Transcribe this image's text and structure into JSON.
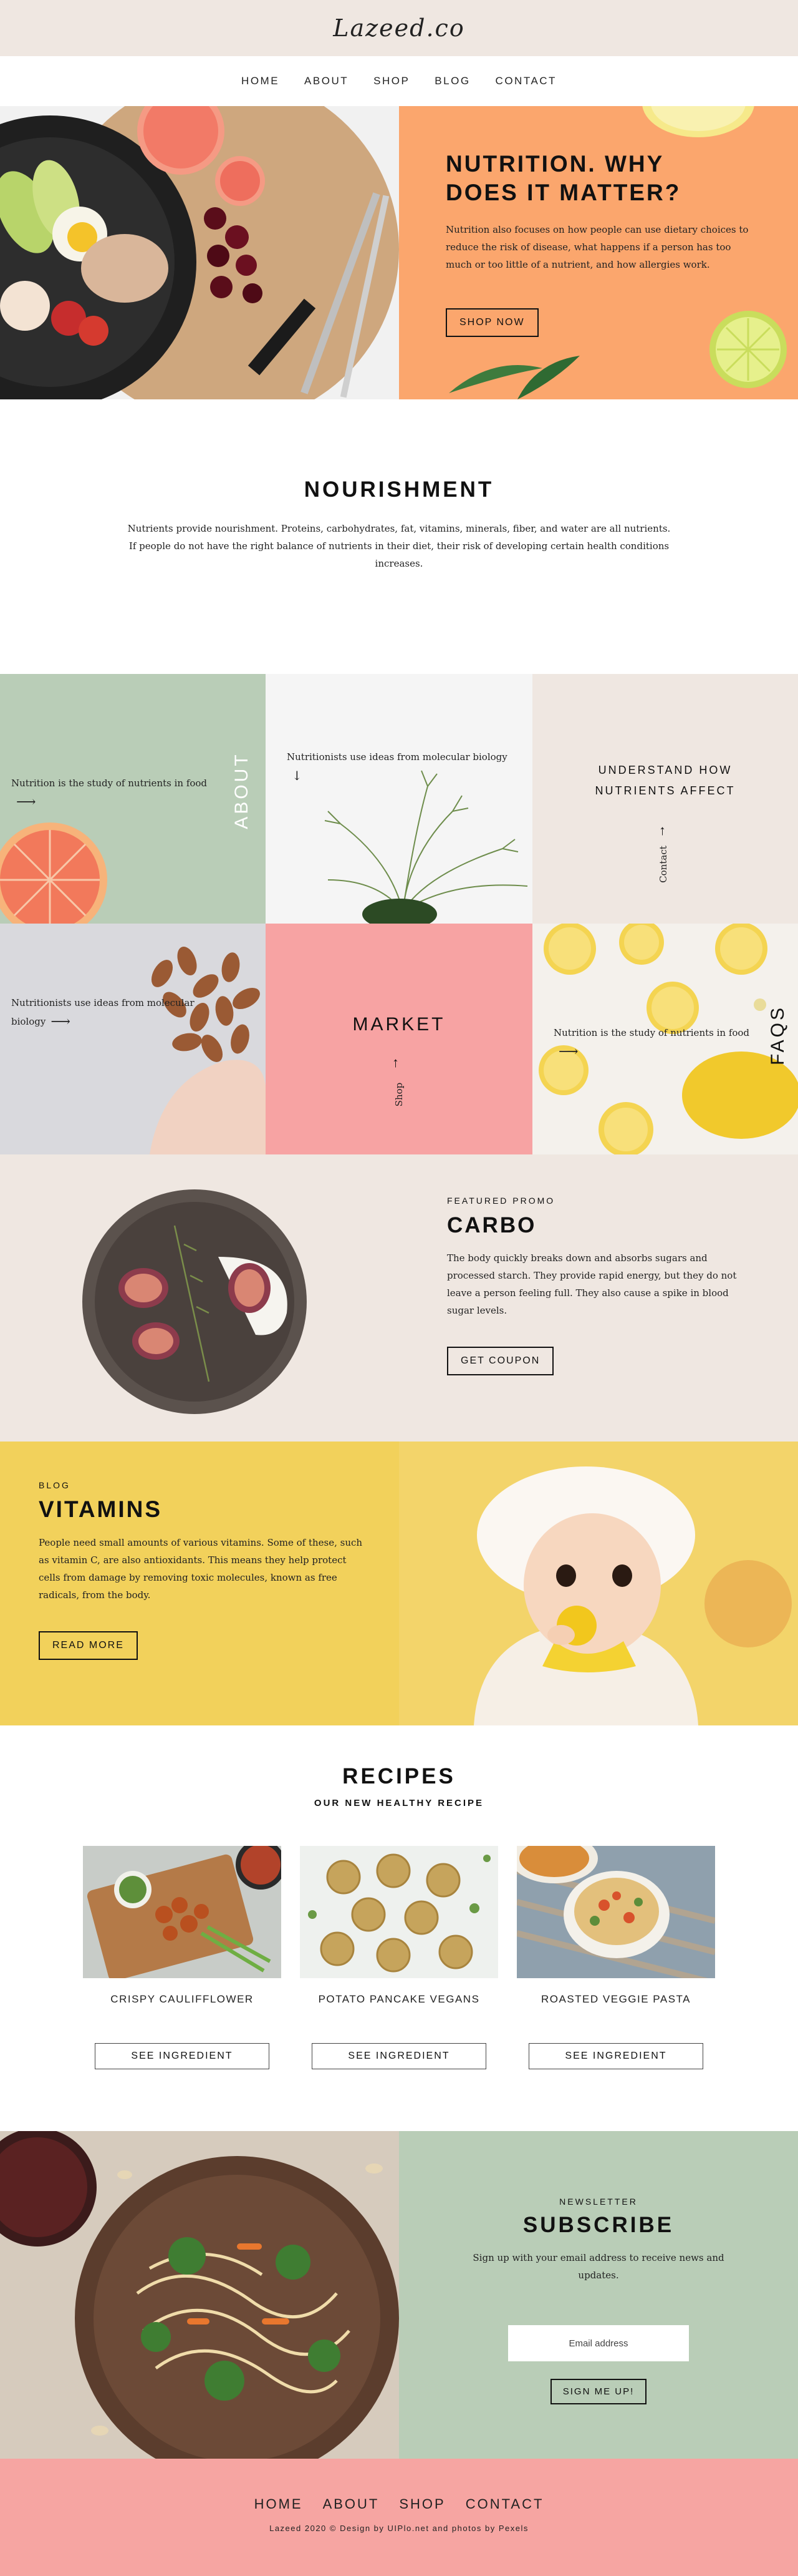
{
  "brand": {
    "logo": "Lazeed.co"
  },
  "nav": [
    "HOME",
    "ABOUT",
    "SHOP",
    "BLOG",
    "CONTACT"
  ],
  "hero": {
    "title": "NUTRITION. WHY DOES IT MATTER?",
    "body": "Nutrition also focuses on how people can use dietary choices to reduce the risk of disease, what happens if a person has too much or too little of a nutrient, and how allergies work.",
    "button": "SHOP NOW",
    "image_icon": "salad-bowl-icon"
  },
  "nourishment": {
    "title": "NOURISHMENT",
    "body": "Nutrients provide nourishment. Proteins, carbohydrates, fat, vitamins, minerals, fiber, and water are all nutrients. If people do not have the right balance of nutrients in their diet, their risk of developing certain health conditions increases."
  },
  "grid": {
    "about": {
      "text": "Nutrition is the study of nutrients in food",
      "label": "ABOUT",
      "image_icon": "grapefruit-icon"
    },
    "biology": {
      "text": "Nutritionists use ideas from molecular biology"
    },
    "understand": {
      "title": "UNDERSTAND HOW NUTRIENTS AFFECT",
      "link": "Contact"
    },
    "almonds": {
      "text": "Nutritionists use ideas from molecular biology"
    },
    "market": {
      "title": "MARKET",
      "link": "Shop"
    },
    "faqs": {
      "text": "Nutrition is the study of nutrients in food",
      "label": "FAQS"
    }
  },
  "promo": {
    "kicker": "FEATURED PROMO",
    "title": "CARBO",
    "body": "The body quickly breaks down and absorbs sugars and processed starch. They provide rapid energy, but they do not leave a person feeling full. They also cause a spike in blood sugar levels.",
    "button": "GET COUPON"
  },
  "vitamins": {
    "kicker": "BLOG",
    "title": "VITAMINS",
    "body": "People need small amounts of various vitamins. Some of these, such as vitamin C, are also antioxidants. This means they help protect cells from damage by removing toxic molecules, known as free radicals, from the body.",
    "button": "READ MORE"
  },
  "recipes": {
    "title": "RECIPES",
    "subtitle": "OUR NEW HEALTHY RECIPE",
    "items": [
      {
        "name": "CRISPY CAULIFFLOWER",
        "button": "SEE INGREDIENT"
      },
      {
        "name": "POTATO PANCAKE VEGANS",
        "button": "SEE INGREDIENT"
      },
      {
        "name": "ROASTED VEGGIE PASTA",
        "button": "SEE INGREDIENT"
      }
    ]
  },
  "newsletter": {
    "kicker": "NEWSLETTER",
    "title": "SUBSCRIBE",
    "body": "Sign up with your email address to receive news and updates.",
    "placeholder": "Email address",
    "button": "SIGN ME UP!"
  },
  "footer": {
    "nav": [
      "HOME",
      "ABOUT",
      "SHOP",
      "CONTACT"
    ],
    "credit": "Lazeed 2020 © Design by UIPlo.net and photos by Pexels"
  },
  "colors": {
    "beige": "#efe7e1",
    "orange": "#fba66d",
    "sage": "#b9cdb7",
    "pink": "#f6a5a2",
    "yellow": "#f2d15b"
  }
}
